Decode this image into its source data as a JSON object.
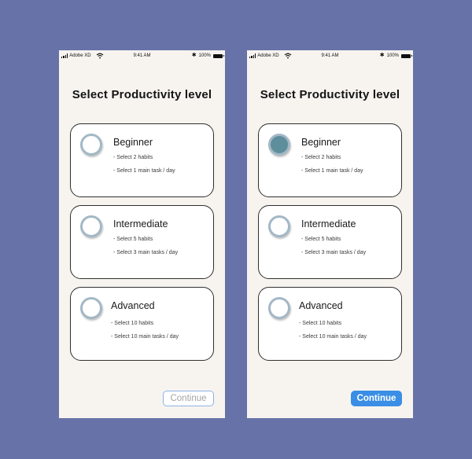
{
  "status_bar": {
    "carrier": "Adobe XD",
    "time": "9:41 AM",
    "battery": "100%"
  },
  "screens": [
    {
      "title": "Select Productivity level",
      "levels": [
        {
          "label": "Beginner",
          "details": [
            "- Select 2 habits",
            "- Select 1 main task / day"
          ],
          "selected": false
        },
        {
          "label": "Intermediate",
          "details": [
            "- Select 5 habits",
            "- Select 3 main tasks / day"
          ],
          "selected": false
        },
        {
          "label": "Advanced",
          "details": [
            "- Select 10 habits",
            "- Select 10 main tasks / day"
          ],
          "selected": false
        }
      ],
      "continue_label": "Continue",
      "continue_state": "disabled"
    },
    {
      "title": "Select Productivity level",
      "levels": [
        {
          "label": "Beginner",
          "details": [
            "- Select 2 habits",
            "- Select 1 main task / day"
          ],
          "selected": true
        },
        {
          "label": "Intermediate",
          "details": [
            "- Select 5 habits",
            "- Select 3 main tasks / day"
          ],
          "selected": false
        },
        {
          "label": "Advanced",
          "details": [
            "- Select 10 habits",
            "- Select 10 main tasks / day"
          ],
          "selected": false
        }
      ],
      "continue_label": "Continue",
      "continue_state": "active"
    }
  ],
  "colors": {
    "background": "#6773a8",
    "screen": "#f7f4f0",
    "radio_selected": "#5e8e9b",
    "radio_ring": "#a3b8c6",
    "continue_active": "#3a8ee5",
    "continue_disabled_border": "#8ab3e3"
  }
}
